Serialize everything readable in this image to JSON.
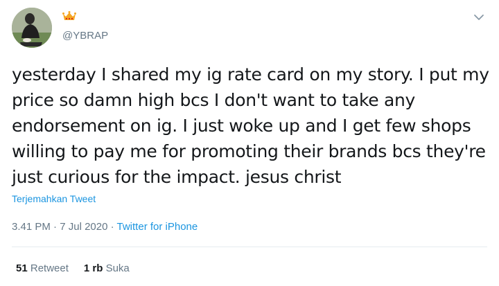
{
  "author": {
    "handle": "@YBRAP",
    "avatar_icon": "profile-photo",
    "badge_icon": "crown-icon",
    "badge_color": "#f5a623"
  },
  "menu_icon": "chevron-down-icon",
  "tweet": {
    "lines": [
      "yesterday I shared my ig rate card on my story. I put my",
      "price so damn high bcs I don't want to take any",
      "endorsement on ig. I just woke up and I get few shops",
      "willing to pay me for promoting their brands bcs they're",
      "just curious for the impact. jesus christ"
    ],
    "translate_label": "Terjemahkan Tweet",
    "time": "3.41 PM",
    "separator1": " · ",
    "date": "7 Jul 2020",
    "separator2": " · ",
    "source": "Twitter for iPhone"
  },
  "stats": {
    "retweets_count": "51",
    "retweets_label": "Retweet",
    "likes_count": "1 rb",
    "likes_label": "Suka"
  },
  "colors": {
    "link": "#1b95e0",
    "muted": "#657786",
    "text": "#14171a",
    "divider": "#e6ecf0"
  }
}
